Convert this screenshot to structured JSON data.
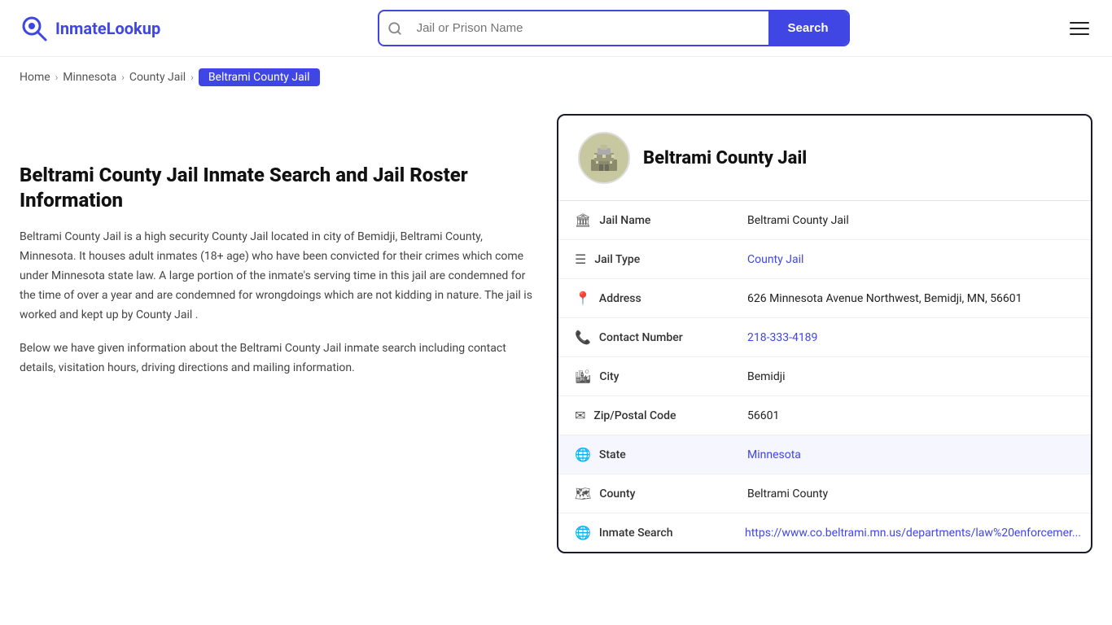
{
  "header": {
    "logo_text_part1": "Inmate",
    "logo_text_part2": "Lookup",
    "search_placeholder": "Jail or Prison Name",
    "search_button_label": "Search"
  },
  "breadcrumb": {
    "items": [
      {
        "label": "Home",
        "href": "#"
      },
      {
        "label": "Minnesota",
        "href": "#"
      },
      {
        "label": "County Jail",
        "href": "#"
      },
      {
        "label": "Beltrami County Jail",
        "current": true
      }
    ]
  },
  "left": {
    "heading": "Beltrami County Jail Inmate Search and Jail Roster Information",
    "desc1": "Beltrami County Jail is a high security County Jail located in city of Bemidji, Beltrami County, Minnesota. It houses adult inmates (18+ age) who have been convicted for their crimes which come under Minnesota state law. A large portion of the inmate's serving time in this jail are condemned for the time of over a year and are condemned for wrongdoings which are not kidding in nature. The jail is worked and kept up by County Jail .",
    "desc2": "Below we have given information about the Beltrami County Jail inmate search including contact details, visitation hours, driving directions and mailing information."
  },
  "card": {
    "jail_name": "Beltrami County Jail",
    "avatar_emoji": "🏛️",
    "rows": [
      {
        "icon": "🏛",
        "label": "Jail Name",
        "value": "Beltrami County Jail",
        "link": false,
        "highlighted": false
      },
      {
        "icon": "☰",
        "label": "Jail Type",
        "value": "County Jail",
        "link": true,
        "highlighted": false
      },
      {
        "icon": "📍",
        "label": "Address",
        "value": "626 Minnesota Avenue Northwest, Bemidji, MN, 56601",
        "link": false,
        "highlighted": false
      },
      {
        "icon": "📞",
        "label": "Contact Number",
        "value": "218-333-4189",
        "link": true,
        "highlighted": false
      },
      {
        "icon": "🏙",
        "label": "City",
        "value": "Bemidji",
        "link": false,
        "highlighted": false
      },
      {
        "icon": "✉",
        "label": "Zip/Postal Code",
        "value": "56601",
        "link": false,
        "highlighted": false
      },
      {
        "icon": "🌐",
        "label": "State",
        "value": "Minnesota",
        "link": true,
        "highlighted": true
      },
      {
        "icon": "🗺",
        "label": "County",
        "value": "Beltrami County",
        "link": false,
        "highlighted": false
      },
      {
        "icon": "🌐",
        "label": "Inmate Search",
        "value": "https://www.co.beltrami.mn.us/departments/law%20enforcemer...",
        "link": true,
        "highlighted": false
      }
    ]
  }
}
